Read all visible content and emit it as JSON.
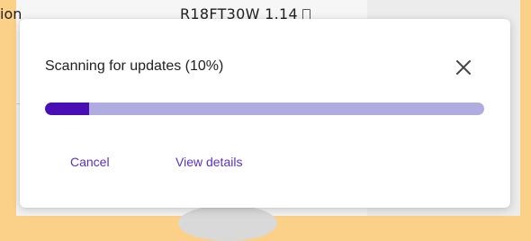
{
  "background": {
    "left_label": "ion",
    "version_text": "R18FT30W 1.14",
    "icon": "copy-icon"
  },
  "dialog": {
    "title": "Scanning for updates (10%)",
    "close_icon": "close-icon",
    "progress": {
      "percent": 10,
      "fill_color": "#4a0fb4",
      "track_color": "#b0acdf"
    },
    "actions": {
      "cancel_label": "Cancel",
      "details_label": "View details"
    },
    "accent_color": "#5b2fc2"
  }
}
